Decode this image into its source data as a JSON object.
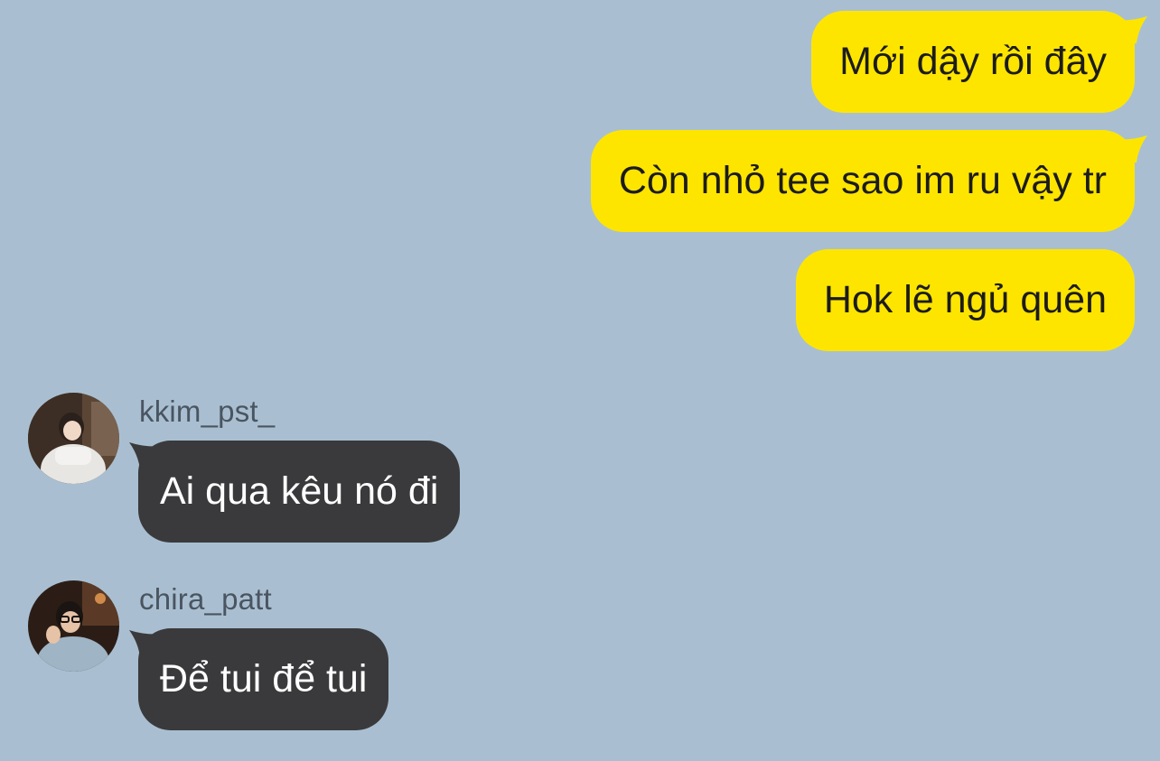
{
  "colors": {
    "background": "#a9bfd1",
    "outgoing_bubble": "#fee500",
    "incoming_bubble": "#3a3a3c",
    "sender_name": "#4a5561"
  },
  "outgoing_messages": [
    {
      "text": "Mới dậy rồi đây"
    },
    {
      "text": "Còn nhỏ tee sao im ru vậy tr"
    },
    {
      "text": "Hok lẽ ngủ quên"
    }
  ],
  "incoming_messages": [
    {
      "sender": "kkim_pst_",
      "avatar_icon": "profile-photo-icon",
      "text": "Ai qua kêu nó đi"
    },
    {
      "sender": "chira_patt",
      "avatar_icon": "profile-photo-icon",
      "text": "Để tui để tui"
    }
  ]
}
